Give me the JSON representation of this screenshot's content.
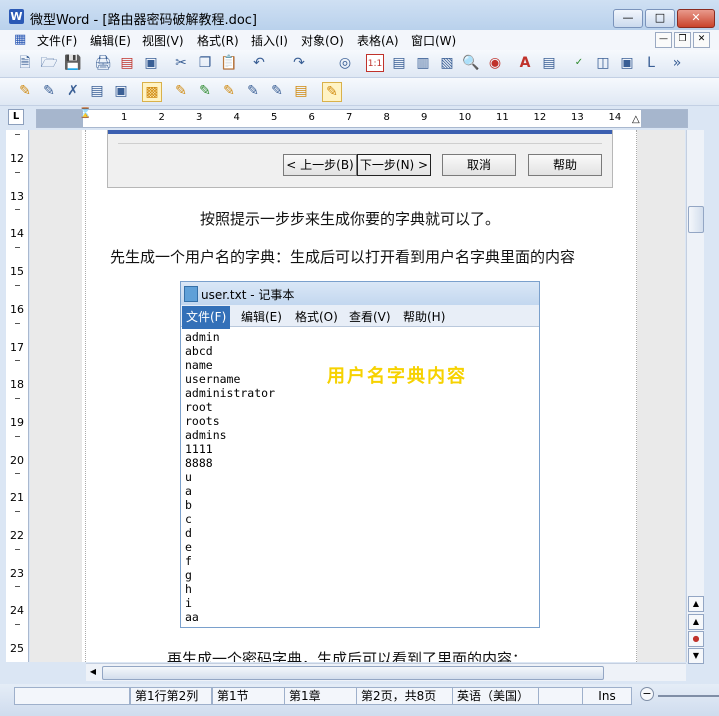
{
  "window": {
    "title": "微型Word - [路由器密码破解教程.doc]",
    "app_icon": "W"
  },
  "menubar": {
    "items": [
      "文件(F)",
      "编辑(E)",
      "视图(V)",
      "格式(R)",
      "插入(I)",
      "对象(O)",
      "表格(A)",
      "窗口(W)"
    ]
  },
  "toolbar1": {
    "icons": [
      "new-doc-icon",
      "open-folder-icon",
      "save-icon",
      "print-icon",
      "pdf-icon",
      "print-preview-icon",
      "cut-icon",
      "copy-icon",
      "paste-icon",
      "undo-icon",
      "redo-icon",
      "find-icon",
      "page-view-icon",
      "web-view-icon",
      "outline-view-icon",
      "two-page-icon",
      "zoom-icon",
      "zoom-to-icon",
      "text-color-icon",
      "style-icon",
      "spellcheck-icon",
      "font-icon",
      "frame-icon",
      "paragraph-icon",
      "more-icon"
    ]
  },
  "toolbar2": {
    "icons": [
      "edit-icon",
      "track-icon",
      "insert-comment-icon",
      "accept-icon",
      "reject-icon",
      "clipboard-icon",
      "stamp-icon",
      "pen-icon",
      "highlighter-icon",
      "eraser-icon",
      "markup-icon",
      "note-icon"
    ]
  },
  "ruler": {
    "corner": "L",
    "h_numbers": [
      "1",
      "2",
      "3",
      "4",
      "5",
      "6",
      "7",
      "8",
      "9",
      "10",
      "11",
      "12",
      "13",
      "14"
    ],
    "v_numbers": [
      "12",
      "13",
      "14",
      "15",
      "16",
      "17",
      "18",
      "19",
      "20",
      "21",
      "22",
      "23",
      "24",
      "25"
    ]
  },
  "dialog": {
    "prev_button": "< 上一步(B)",
    "next_button": "下一步(N) >",
    "cancel_button": "取消",
    "help_button": "帮助"
  },
  "document": {
    "para1": "按照提示一步步来生成你要的字典就可以了。",
    "para2": "先生成一个用户名的字典：生成后可以打开看到用户名字典里面的内容",
    "para3": "再生成一个密码字典，生成后可以看到了里面的内容："
  },
  "notepad": {
    "title": "user.txt - 记事本",
    "menu": {
      "file": "文件(F)",
      "edit": "编辑(E)",
      "format": "格式(O)",
      "view": "查看(V)",
      "help": "帮助(H)"
    },
    "lines": [
      "admin",
      "abcd",
      "name",
      "username",
      "administrator",
      "root",
      "roots",
      "admins",
      "1111",
      "8888",
      "u",
      "a",
      "b",
      "c",
      "d",
      "e",
      "f",
      "g",
      "h",
      "i",
      "aa"
    ],
    "overlay_text": "用户名字典内容"
  },
  "statusbar": {
    "position": "第1行第2列",
    "section": "第1节",
    "chapter": "第1章",
    "page": "第2页，共8页",
    "language": "英语（美国）",
    "mode": "Ins"
  },
  "colors": {
    "overlay": "#f6d200",
    "accent": "#3370b8"
  }
}
